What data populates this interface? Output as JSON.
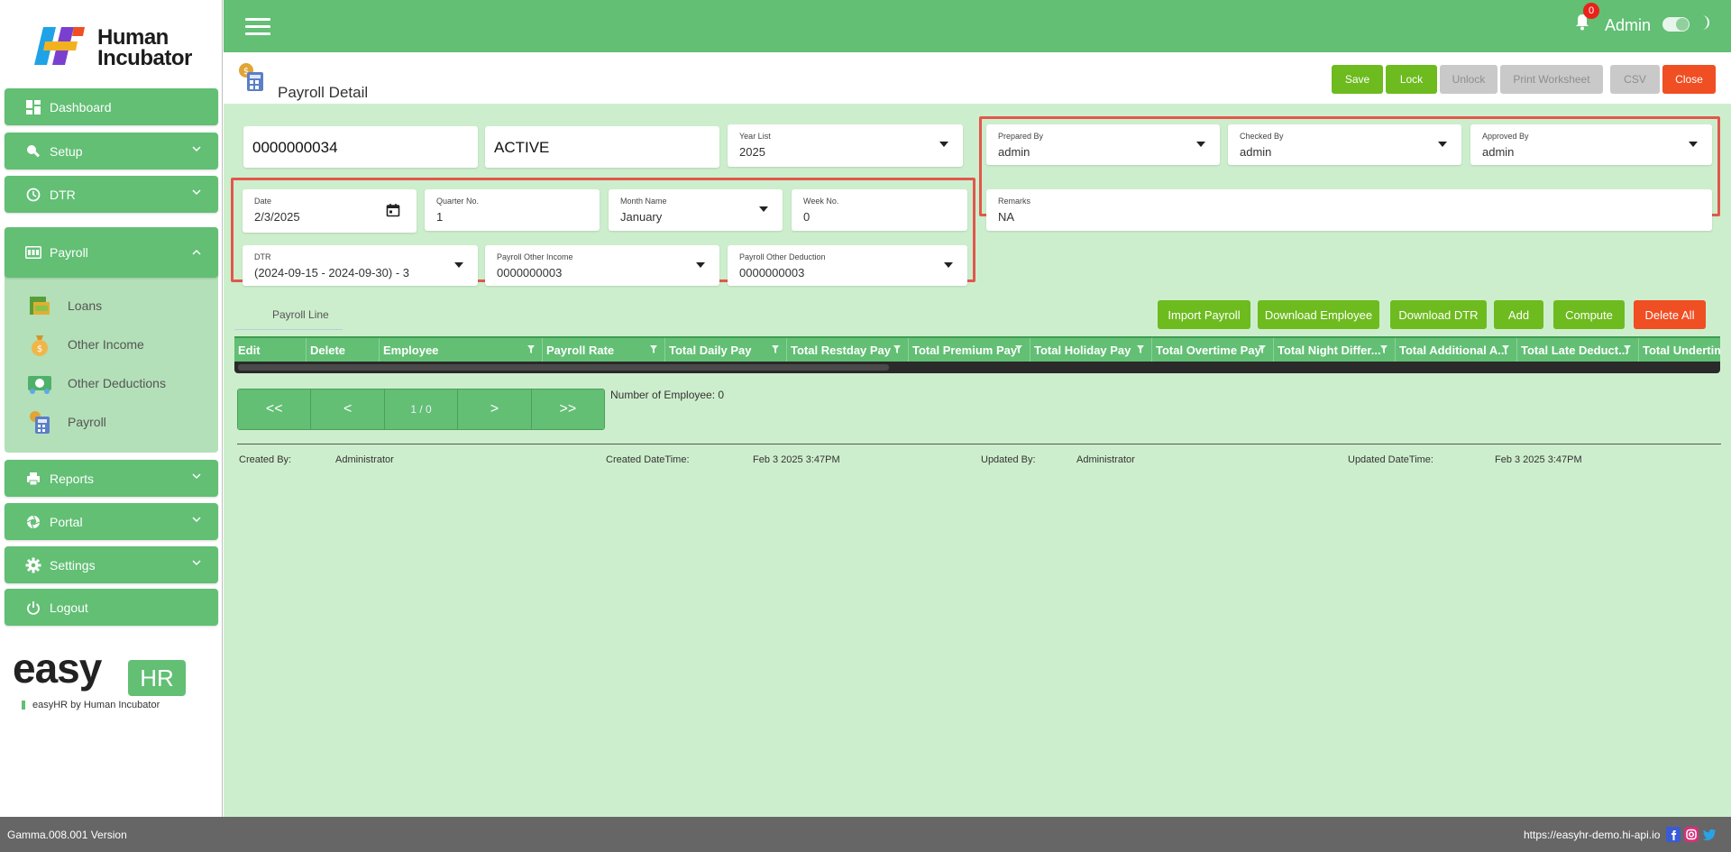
{
  "brand": {
    "name_line1": "Human",
    "name_line2": "Incubator"
  },
  "sidebar": {
    "items": [
      {
        "label": "Dashboard",
        "icon": "dashboard-icon"
      },
      {
        "label": "Setup",
        "icon": "wrench-icon"
      },
      {
        "label": "DTR",
        "icon": "clock-icon"
      },
      {
        "label": "Payroll",
        "icon": "payroll-icon"
      },
      {
        "label": "Reports",
        "icon": "printer-icon"
      },
      {
        "label": "Portal",
        "icon": "aperture-icon"
      },
      {
        "label": "Settings",
        "icon": "gear-icon"
      },
      {
        "label": "Logout",
        "icon": "power-icon"
      }
    ],
    "payroll_sub": [
      {
        "label": "Loans",
        "icon": "money-icon"
      },
      {
        "label": "Other Income",
        "icon": "money-bag-icon"
      },
      {
        "label": "Other Deductions",
        "icon": "cash-icon"
      },
      {
        "label": "Payroll",
        "icon": "calculator-icon"
      }
    ]
  },
  "easyhr": {
    "word": "easy",
    "box": "HR",
    "tagline": "easyHR by Human Incubator"
  },
  "topbar": {
    "notification_count": "0",
    "user": "Admin"
  },
  "header": {
    "title": "Payroll Detail",
    "buttons": {
      "save": "Save",
      "lock": "Lock",
      "unlock": "Unlock",
      "print": "Print Worksheet",
      "csv": "CSV",
      "close": "Close"
    }
  },
  "form": {
    "payroll_no": "0000000034",
    "status": "ACTIVE",
    "year_list": {
      "label": "Year List",
      "value": "2025"
    },
    "prepared_by": {
      "label": "Prepared By",
      "value": "admin"
    },
    "checked_by": {
      "label": "Checked By",
      "value": "admin"
    },
    "approved_by": {
      "label": "Approved By",
      "value": "admin"
    },
    "date": {
      "label": "Date",
      "value": "2/3/2025"
    },
    "quarter": {
      "label": "Quarter No.",
      "value": "1"
    },
    "month": {
      "label": "Month Name",
      "value": "January"
    },
    "week": {
      "label": "Week No.",
      "value": "0"
    },
    "remarks": {
      "label": "Remarks",
      "value": "NA"
    },
    "dtr": {
      "label": "DTR",
      "value": "(2024-09-15 - 2024-09-30) - 3"
    },
    "other_income": {
      "label": "Payroll Other Income",
      "value": "0000000003"
    },
    "other_deduction": {
      "label": "Payroll Other Deduction",
      "value": "0000000003"
    }
  },
  "payroll_line": {
    "tab": "Payroll Line",
    "buttons": {
      "import": "Import Payroll",
      "download_employee": "Download Employee",
      "download_dtr": "Download DTR",
      "add": "Add",
      "compute": "Compute",
      "delete_all": "Delete All"
    },
    "columns": [
      "Edit",
      "Delete",
      "Employee",
      "Payroll Rate",
      "Total Daily Pay",
      "Total Restday Pay",
      "Total Premium Pay",
      "Total Holiday Pay",
      "Total Overtime Pay",
      "Total Night Differ...",
      "Total Additional A...",
      "Total Late Deduct...",
      "Total Undertim"
    ],
    "pager": {
      "first": "<<",
      "prev": "<",
      "page": "1 / 0",
      "next": ">",
      "last": ">>"
    },
    "employee_count": "Number of Employee: 0"
  },
  "audit": {
    "created_by_label": "Created By:",
    "created_by": "Administrator",
    "created_dt_label": "Created DateTime:",
    "created_dt": "Feb 3 2025 3:47PM",
    "updated_by_label": "Updated By:",
    "updated_by": "Administrator",
    "updated_dt_label": "Updated DateTime:",
    "updated_dt": "Feb 3 2025 3:47PM"
  },
  "footer": {
    "version": "Gamma.008.001 Version",
    "url": "https://easyhr-demo.hi-api.io"
  },
  "colors": {
    "primary": "#62bf74",
    "content_bg": "#cdeecd",
    "action_green": "#6dbb1f",
    "danger": "#f04e23",
    "highlight": "#e2574c"
  }
}
